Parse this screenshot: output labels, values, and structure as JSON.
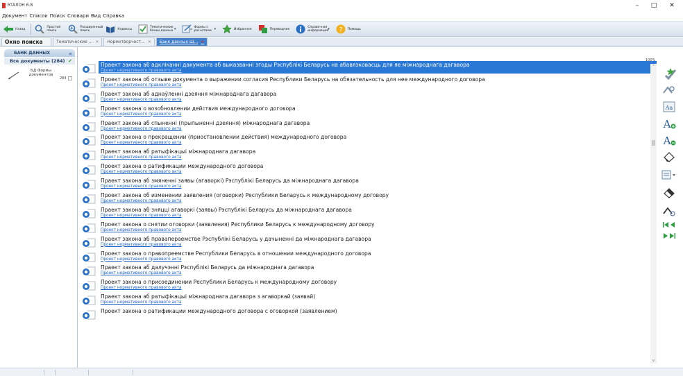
{
  "window": {
    "title": "ЭТАЛОН 6.8",
    "minimize": "–",
    "maximize": "□",
    "close": "✕"
  },
  "menu": [
    "Документ",
    "Список",
    "Поиск",
    "Словари",
    "Вид",
    "Справка"
  ],
  "toolbar": {
    "back": "Назад",
    "simple_search": "Простой поиск",
    "extended_search": "Расширенный поиск",
    "codes": "Кодексы",
    "thematic_banks": "Тематические банки данных",
    "forms": "Формы с расчетами",
    "favorites": "Избранное",
    "translation": "Переводчик",
    "reference_info": "Справочная информация",
    "help": "Помощь"
  },
  "tabs": [
    {
      "label": "Окно поиска"
    },
    {
      "label": "Тематические ..."
    },
    {
      "label": "Нормотворчест..."
    },
    {
      "label": "Банк данных Ш..."
    }
  ],
  "left_panel": {
    "header": "БАНК ДАННЫХ",
    "all_docs": "Все документы (284)",
    "bank_label": "БД Формы документов",
    "bank_count": "284"
  },
  "list_zoom": "100%",
  "documents": [
    {
      "title": "Праект закона аб адкліканні дакумента аб выказванні згоды Рэспублікі Беларусь на абавязковасць для яе міжнароднага дагавора",
      "subtitle": "Проект нормативного правового акта"
    },
    {
      "title": "Проект закона об отзыве документа о выражении согласия Республики Беларусь на обязательность для нее международного договора",
      "subtitle": "Проект нормативного правового акта"
    },
    {
      "title": "Праект закона аб аднаўленні дзеяння міжнароднага дагавора",
      "subtitle": "Проект нормативного правового акта"
    },
    {
      "title": "Проект закона о возобновлении действия международного договора",
      "subtitle": "Проект нормативного правового акта"
    },
    {
      "title": "Праект закона аб спыненні (прыпыненні дзеяння) міжнароднага дагавора",
      "subtitle": "Проект нормативного правового акта"
    },
    {
      "title": "Проект закона о прекращении (приостановлении действия) международного договора",
      "subtitle": "Проект нормативного правового акта"
    },
    {
      "title": "Праект закона аб ратыфікацыі міжнароднага дагавора",
      "subtitle": "Проект нормативного правового акта"
    },
    {
      "title": "Проект закона о ратификации международного договора",
      "subtitle": "Проект нормативного правового акта"
    },
    {
      "title": "Праект закона аб змяненні заявы (агаворкі) Рэспублікі Беларусь да міжнароднага дагавора",
      "subtitle": "Проект нормативного правового акта"
    },
    {
      "title": "Проект закона об изменении заявления (оговорки) Республики Беларусь к международному договору",
      "subtitle": "Проект нормативного правового акта"
    },
    {
      "title": "Праект закона аб зняцці агаворкі (заявы) Рэспублікі Беларусь да міжнароднага дагавора",
      "subtitle": "Проект нормативного правового акта"
    },
    {
      "title": "Проект закона о снятии оговорки (заявления) Республики Беларусь к международному договору",
      "subtitle": "Проект нормативного правового акта"
    },
    {
      "title": "Праект закона аб правапераемстве Рэспублікі Беларусь у дачыненні да міжнароднага дагавора",
      "subtitle": "Проект нормативного правового акта"
    },
    {
      "title": "Проект закона о правопреемстве Республики Беларусь в отношении международного договора",
      "subtitle": "Проект нормативного правового акта"
    },
    {
      "title": "Праект закона аб далучэнні Рэспублікі Беларусь да міжнароднага дагавора",
      "subtitle": "Проект нормативного правового акта"
    },
    {
      "title": "Проект закона о присоединении Республики Беларусь к международному договору",
      "subtitle": "Проект нормативного правового акта"
    },
    {
      "title": "Праект закона аб ратыфікацыі міжнароднага дагавора з агаворкай (заявай)",
      "subtitle": "Проект нормативного правового акта"
    },
    {
      "title": "Проект закона о ратификации международного договора с оговоркой (заявлением)",
      "subtitle": ""
    }
  ],
  "colors": {
    "selection": "#2a78d6",
    "link": "#1b5fc4",
    "brand_red": "#d9302b"
  }
}
